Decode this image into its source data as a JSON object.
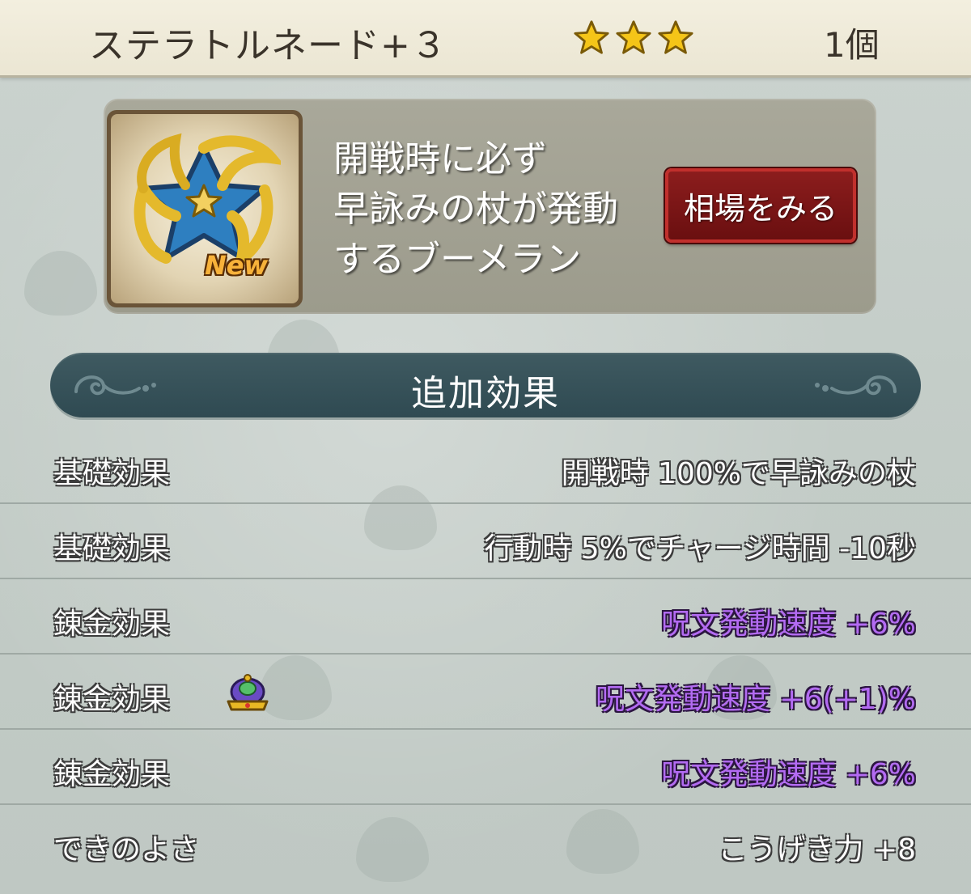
{
  "header": {
    "item_name": "ステラトルネード+３",
    "star_rating": 3,
    "quantity": "1個"
  },
  "item": {
    "icon": "star-boomerang-icon",
    "new_badge": "New",
    "description_lines": [
      "開戦時に必ず",
      "早詠みの杖が発動",
      "するブーメラン"
    ],
    "market_button_label": "相場をみる"
  },
  "section": {
    "title": "追加効果"
  },
  "effects": [
    {
      "label": "基礎効果",
      "value": "開戦時  100%で早詠みの杖",
      "color": "#ffffff"
    },
    {
      "label": "基礎効果",
      "value": "行動時  5%でチャージ時間  -10秒",
      "color": "#ffffff"
    },
    {
      "label": "錬金効果",
      "value": "呪文発動速度  +6%",
      "color": "#b36bf2"
    },
    {
      "label": "錬金効果",
      "value": "呪文発動速度  +6(+1)%",
      "color": "#b36bf2",
      "icon": "crown-icon"
    },
    {
      "label": "錬金効果",
      "value": "呪文発動速度  +6%",
      "color": "#b36bf2"
    },
    {
      "label": "できのよさ",
      "value": "こうげき力  +8",
      "color": "#ffffff"
    }
  ],
  "colors": {
    "alchemy_text": "#b36bf2",
    "market_button": "#7a1414",
    "banner": "#35505a",
    "star": "#f5c518"
  }
}
